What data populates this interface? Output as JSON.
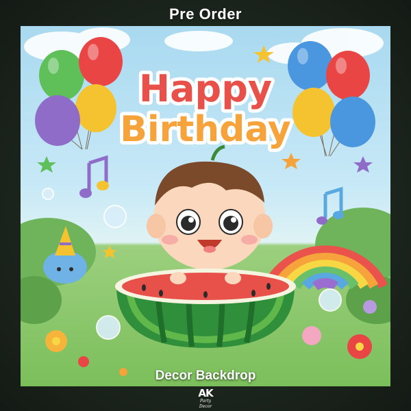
{
  "header": {
    "label": "Pre Order"
  },
  "artwork": {
    "headline_line1": "Happy",
    "headline_line2": "Birthday",
    "colors": {
      "sky": "#a9d9f0",
      "grass": "#7bbf5b",
      "watermelon_rind": "#2f8f3a",
      "watermelon_flesh": "#e8504a"
    }
  },
  "footer": {
    "label": "Decor Backdrop"
  },
  "logo": {
    "mark": "AK",
    "tagline": "Party Decor"
  }
}
